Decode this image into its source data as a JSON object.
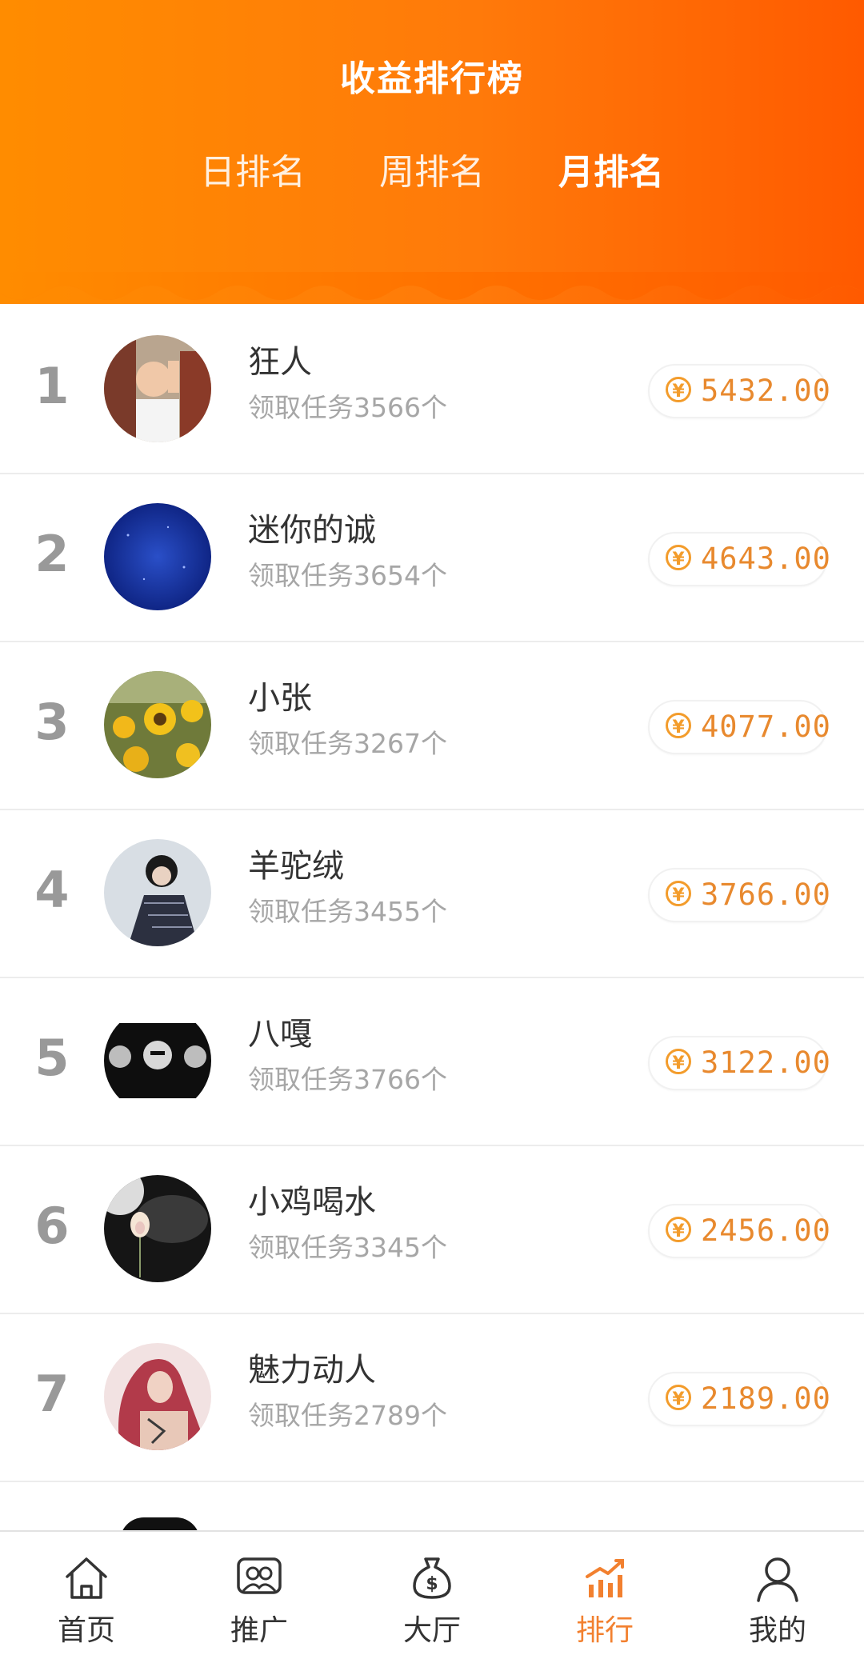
{
  "header": {
    "title": "收益排行榜",
    "tabs": [
      {
        "label": "日排名",
        "active": false
      },
      {
        "label": "周排名",
        "active": false
      },
      {
        "label": "月排名",
        "active": true
      }
    ]
  },
  "currency_symbol": "¥",
  "ranking": [
    {
      "rank": "1",
      "name": "狂人",
      "tasks": "领取任务3566个",
      "amount": "5432.00"
    },
    {
      "rank": "2",
      "name": "迷你的诚",
      "tasks": "领取任务3654个",
      "amount": "4643.00"
    },
    {
      "rank": "3",
      "name": "小张",
      "tasks": "领取任务3267个",
      "amount": "4077.00"
    },
    {
      "rank": "4",
      "name": "羊驼绒",
      "tasks": "领取任务3455个",
      "amount": "3766.00"
    },
    {
      "rank": "5",
      "name": "八嘎",
      "tasks": "领取任务3766个",
      "amount": "3122.00"
    },
    {
      "rank": "6",
      "name": "小鸡喝水",
      "tasks": "领取任务3345个",
      "amount": "2456.00"
    },
    {
      "rank": "7",
      "name": "魅力动人",
      "tasks": "领取任务2789个",
      "amount": "2189.00"
    }
  ],
  "bottom_nav": [
    {
      "label": "首页",
      "icon": "home-icon",
      "active": false
    },
    {
      "label": "推广",
      "icon": "promote-icon",
      "active": false
    },
    {
      "label": "大厅",
      "icon": "money-bag-icon",
      "active": false
    },
    {
      "label": "排行",
      "icon": "ranking-chart-icon",
      "active": true
    },
    {
      "label": "我的",
      "icon": "user-icon",
      "active": false
    }
  ],
  "colors": {
    "header_gradient_start": "#ff8c00",
    "header_gradient_end": "#ff5a00",
    "amount_color": "#e8892e",
    "active_nav": "#f2802f"
  }
}
